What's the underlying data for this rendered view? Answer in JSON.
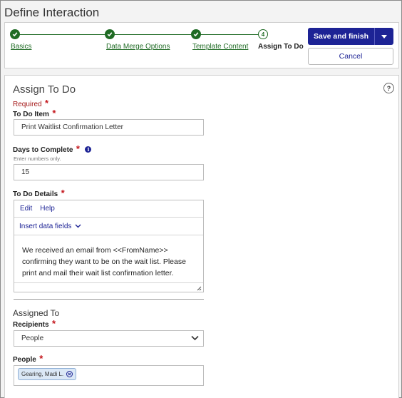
{
  "page": {
    "title": "Define Interaction"
  },
  "stepper": {
    "steps": [
      {
        "label": "Basics",
        "status": "complete"
      },
      {
        "label": "Data Merge Options",
        "status": "complete"
      },
      {
        "label": "Template Content",
        "status": "complete"
      },
      {
        "label": "Assign To Do",
        "status": "current",
        "number": "4"
      }
    ]
  },
  "actions": {
    "save_label": "Save and finish",
    "cancel_label": "Cancel"
  },
  "form": {
    "section_title": "Assign To Do",
    "required_note": "Required",
    "required_star": "*",
    "help_icon_glyph": "?",
    "todo_item": {
      "label": "To Do Item",
      "value": "Print Waitlist Confirmation Letter"
    },
    "days": {
      "label": "Days to Complete",
      "hint": "Enter numbers only.",
      "value": "15",
      "info_glyph": "i"
    },
    "details": {
      "label": "To Do Details",
      "menu": [
        "Edit",
        "Help"
      ],
      "insert_label": "Insert data fields",
      "body": "We received an email from <<FromName>> confirming they want to be on the wait list. Please print and mail their wait list confirmation letter."
    },
    "assigned": {
      "section_title": "Assigned To",
      "recipients_label": "Recipients",
      "recipients_value": "People",
      "people_label": "People",
      "people_chips": [
        "Gearing, Madi L."
      ]
    }
  },
  "colors": {
    "brand": "#1d2395",
    "success": "#1f6b24",
    "required": "#c4161c"
  },
  "icons": {
    "check": "check-icon",
    "caret": "caret-down-icon",
    "chevron": "chevron-down-icon",
    "info": "info-icon",
    "help": "help-icon",
    "remove": "remove-icon",
    "resize": "resize-grip-icon"
  }
}
